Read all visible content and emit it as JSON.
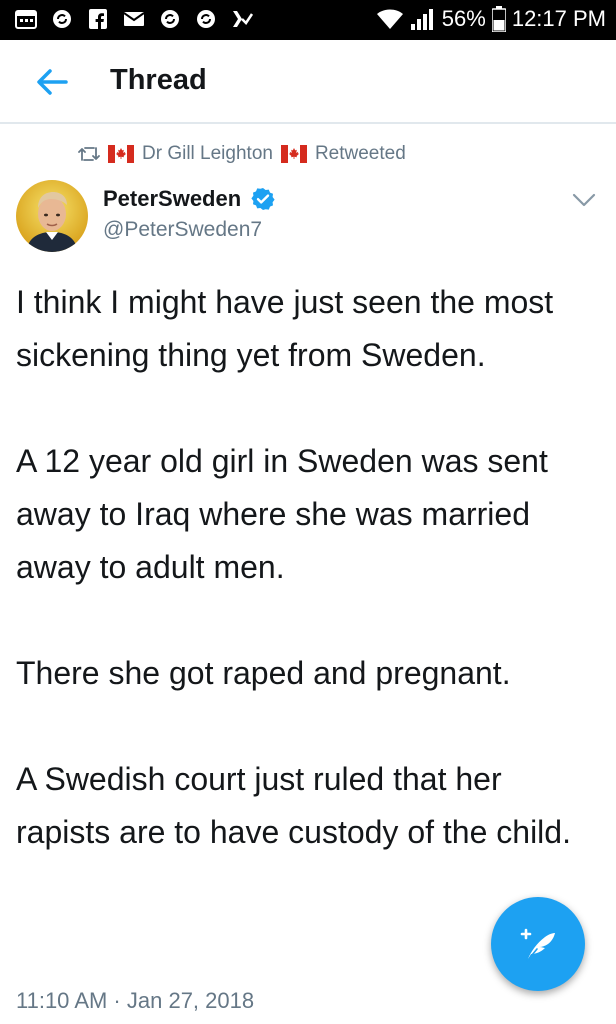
{
  "status_bar": {
    "battery": "56%",
    "time": "12:17 PM",
    "left_icons": [
      "calendar-icon",
      "sync-icon",
      "facebook-icon",
      "mail-icon",
      "sync-icon",
      "sync-icon",
      "checkmark-icon"
    ]
  },
  "header": {
    "title": "Thread",
    "back_icon": "back-arrow-icon"
  },
  "retweet_context": {
    "retweeter": "Dr Gill Leighton",
    "action": "Retweeted"
  },
  "tweet": {
    "author_name": "PeterSweden",
    "author_handle": "@PeterSweden7",
    "verified": true,
    "paragraphs": [
      "I think I might have just seen the most sickening thing yet from Sweden.",
      "A 12 year old girl in Sweden was sent away to Iraq where she was married away to adult men.",
      "There she got raped and pregnant.",
      "A Swedish court just ruled that her rapists are to have custody of the child."
    ],
    "timestamp": "11:10 AM · Jan 27, 2018"
  },
  "colors": {
    "accent": "#1da1f2",
    "text_primary": "#14171a",
    "text_secondary": "#657786",
    "divider": "#e1e8ed"
  }
}
